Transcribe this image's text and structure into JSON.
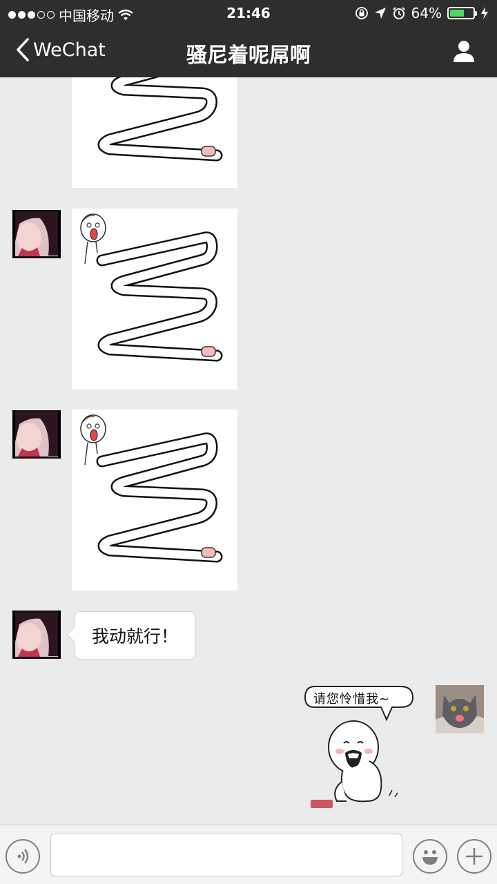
{
  "status_bar": {
    "carrier": "中国移动",
    "time": "21:46",
    "battery": "64%",
    "battery_level": 0.64,
    "signal_dots_filled": 3,
    "signal_dots_total": 5,
    "icons": [
      "wifi-icon",
      "orientation-lock-icon",
      "location-icon",
      "alarm-icon",
      "battery-icon",
      "charging-icon"
    ]
  },
  "nav_bar": {
    "back_label": "WeChat",
    "title": "骚尼着呢屌啊",
    "icons": [
      "back-chevron-icon",
      "profile-icon"
    ]
  },
  "messages": [
    {
      "sender": "other",
      "type": "sticker",
      "content": "zigzag-arm-sticker"
    },
    {
      "sender": "other",
      "type": "sticker",
      "content": "zigzag-arm-sticker"
    },
    {
      "sender": "other",
      "type": "sticker",
      "content": "zigzag-arm-sticker"
    },
    {
      "sender": "other",
      "type": "text",
      "text": "我动就行！"
    },
    {
      "sender": "me",
      "type": "sticker",
      "content": "bald-man-sticker",
      "caption": "请您怜惜我~"
    }
  ],
  "input_bar": {
    "value": "",
    "icons": [
      "voice-icon",
      "emoji-icon",
      "plus-icon"
    ]
  },
  "colors": {
    "bar_bg": "#2e2e2e",
    "chat_bg": "#ebebeb",
    "battery_green": "#4cd964",
    "skin_pink": "#f6bcbc"
  }
}
